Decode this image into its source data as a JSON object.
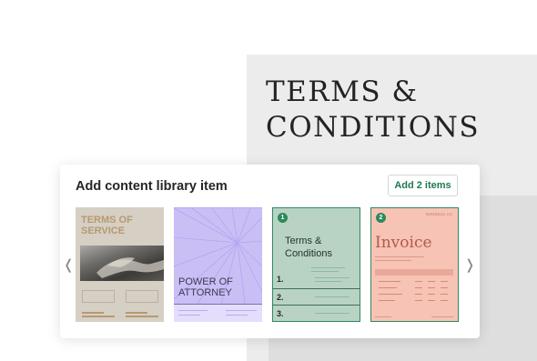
{
  "background_document": {
    "title": "TERMS &\nCONDITIONS"
  },
  "dialog": {
    "title": "Add content library item",
    "add_button_label": "Add 2 items",
    "nav_prev": "❬",
    "nav_next": "❭",
    "accent_color": "#1e7a52",
    "templates": [
      {
        "title": "TERMS OF\nSERVICE",
        "selected": false
      },
      {
        "title": "POWER OF\nATTORNEY",
        "selected": false
      },
      {
        "title": "Terms &\nConditions",
        "selected": true,
        "badge": "1",
        "items": [
          "1.",
          "2.",
          "3."
        ]
      },
      {
        "title": "Invoice",
        "selected": true,
        "badge": "2",
        "header_text": "PAPERDOC CO."
      }
    ]
  }
}
